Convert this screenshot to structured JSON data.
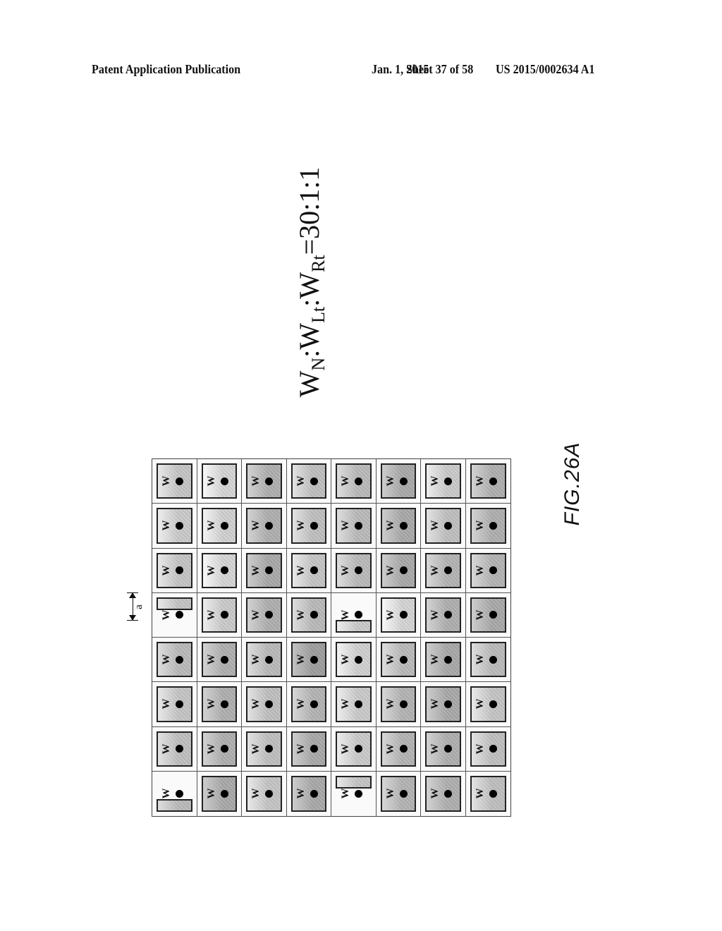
{
  "header": {
    "left": "Patent Application Publication",
    "date": "Jan. 1, 2015",
    "sheet": "Sheet 37 of 58",
    "number": "US 2015/0002634 A1"
  },
  "ratio_formula": {
    "parts": [
      {
        "base": "W",
        "sub": "N"
      },
      {
        "sep": ":"
      },
      {
        "base": "W",
        "sub": "Lt"
      },
      {
        "sep": ":"
      },
      {
        "base": "W",
        "sub": "Rt"
      },
      {
        "sep": "=30:1:1"
      }
    ],
    "text": "WN:WLt:WRt=30:1:1"
  },
  "figure_label": "FIG.26A",
  "dimension_label": "a",
  "grid": {
    "rows": 8,
    "cols": 8,
    "pixel_label": "W",
    "shades": [
      [
        0.35,
        0.2,
        0.55,
        0.4,
        0.45,
        0.6,
        0.3,
        0.55
      ],
      [
        0.3,
        0.25,
        0.55,
        0.4,
        0.45,
        0.6,
        0.4,
        0.55
      ],
      [
        0.35,
        0.2,
        0.6,
        0.35,
        0.45,
        0.6,
        0.5,
        0.5
      ],
      [
        0.35,
        0.3,
        0.55,
        0.45,
        0.3,
        0.2,
        0.55,
        0.6
      ],
      [
        0.45,
        0.55,
        0.45,
        0.7,
        0.25,
        0.45,
        0.6,
        0.45
      ],
      [
        0.35,
        0.55,
        0.4,
        0.5,
        0.3,
        0.5,
        0.6,
        0.35
      ],
      [
        0.4,
        0.55,
        0.4,
        0.6,
        0.3,
        0.5,
        0.55,
        0.4
      ],
      [
        0.45,
        0.6,
        0.35,
        0.6,
        0.35,
        0.5,
        0.55,
        0.4
      ]
    ],
    "special_cells": [
      {
        "row": 3,
        "col": 0,
        "type": "bar-top"
      },
      {
        "row": 3,
        "col": 4,
        "type": "bar-bottom"
      },
      {
        "row": 7,
        "col": 0,
        "type": "bar-bottom"
      },
      {
        "row": 7,
        "col": 4,
        "type": "bar-top"
      }
    ]
  }
}
